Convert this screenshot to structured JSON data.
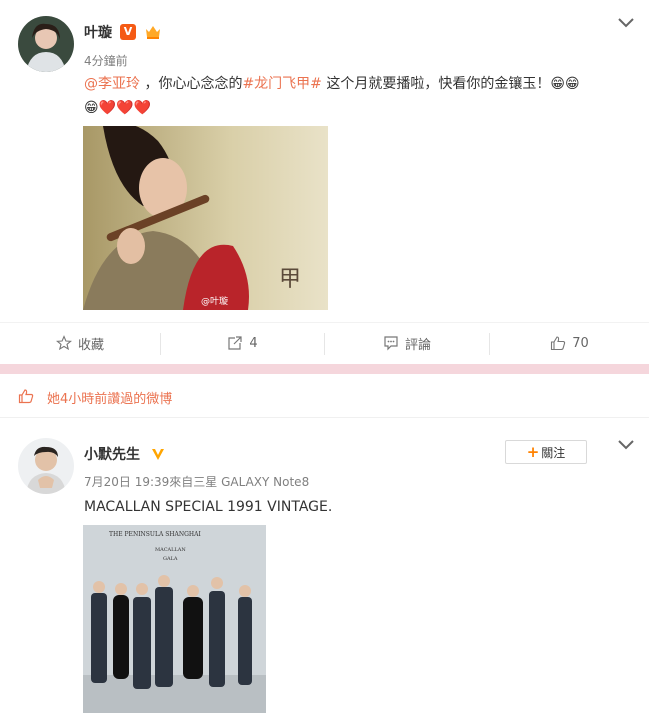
{
  "post1": {
    "user_name": "叶璇",
    "verified_label": "V",
    "time": "4分鐘前",
    "mention": "@李亚玲",
    "text_a": " ，你心心念念的",
    "hashtag": "#龙门飞甲#",
    "text_b": " 这个月就要播啦，快看你的金镶玉！",
    "emoji_grin": "😁😁",
    "emoji_line2": "😁❤️❤️❤️",
    "image_watermark": "@叶璇",
    "actions": {
      "favorite_label": "收藏",
      "repost_count": "4",
      "comment_label": "評論",
      "like_count": "70"
    }
  },
  "liked_bar": {
    "text": "她4小時前讚過的微博"
  },
  "post2": {
    "user_name": "小默先生",
    "time_source": "7月20日 19:39來自三星 GALAXY Note8",
    "text": "MACALLAN SPECIAL 1991 VINTAGE.",
    "follow_label": "關注",
    "image_header": "THE PENINSULA SHANGHAI",
    "image_sub1": "MACALLAN",
    "image_sub2": "GALA"
  },
  "colors": {
    "accent": "#eb7350",
    "orange": "#ff8200",
    "pink_divider": "#f5d6dc"
  }
}
